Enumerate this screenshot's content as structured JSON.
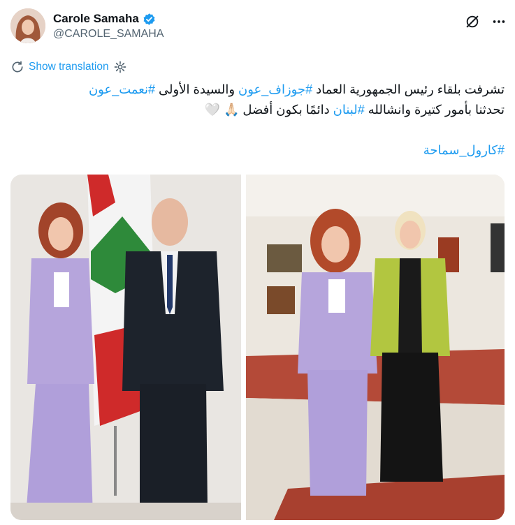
{
  "author": {
    "display_name": "Carole Samaha",
    "handle": "@CAROLE_SAMAHA",
    "verified": true,
    "avatar_icon": "profile-avatar"
  },
  "header_actions": {
    "grok_icon": "grok-icon",
    "more_icon": "more-icon"
  },
  "translation": {
    "label": "Show translation",
    "globe_icon": "translate-icon",
    "settings_icon": "gear-icon"
  },
  "tweet": {
    "line1_a": "تشرفت بلقاء رئيس الجمهورية العماد ",
    "line1_tag1": "#جوزاف_عون",
    "line1_b": " والسيدة الأولى ",
    "line1_tag2": "#نعمت_عون",
    "line2_a": "تحدثنا بأمور كتيرة وانشالله ",
    "line2_tag": "#لبنان",
    "line2_b": " دائمًا بكون أفضل ",
    "emoji": "🙏🏻 🤍",
    "line3_tag": "#كارول_سماحة"
  },
  "media": {
    "photo1_alt": "photo-with-president",
    "photo2_alt": "photo-with-first-lady"
  },
  "colors": {
    "link": "#1d9bf0",
    "muted": "#536471",
    "verified": "#1d9bf0"
  }
}
